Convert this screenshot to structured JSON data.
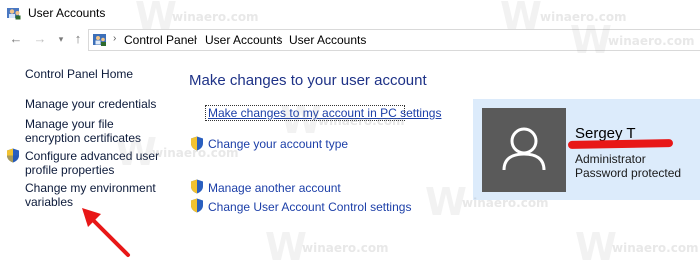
{
  "window": {
    "title": "User Accounts",
    "app_icon": "user-accounts-icon"
  },
  "nav": {
    "back_icon": "arrow-left-icon",
    "forward_icon": "arrow-right-icon",
    "recent_icon": "chevron-down-icon",
    "up_icon": "arrow-up-icon",
    "breadcrumb": [
      "Control Panel",
      "User Accounts",
      "User Accounts"
    ]
  },
  "left_pane": {
    "links": [
      {
        "label": "Control Panel Home",
        "shield": false
      },
      {
        "label": "Manage your credentials",
        "shield": false
      },
      {
        "label": "Manage your file encryption certificates",
        "shield": false
      },
      {
        "label": "Configure advanced user profile properties",
        "shield": true
      },
      {
        "label": "Change my environment variables",
        "shield": false
      }
    ]
  },
  "main": {
    "heading": "Make changes to your user account",
    "links": [
      {
        "label": "Make changes to my account in PC settings",
        "shield": false,
        "focused": true
      },
      {
        "label": "Change your account type",
        "shield": true
      },
      {
        "label": "Manage another account",
        "shield": true
      },
      {
        "label": "Change User Account Control settings",
        "shield": true
      }
    ]
  },
  "user": {
    "name": "Sergey T",
    "role": "Administrator",
    "status": "Password protected"
  },
  "watermark": {
    "text": "winaero.com"
  },
  "colors": {
    "link": "#1c3fa8",
    "heading": "#1e3287",
    "card_bg": "#dcebfb",
    "annotation": "#e81717"
  }
}
